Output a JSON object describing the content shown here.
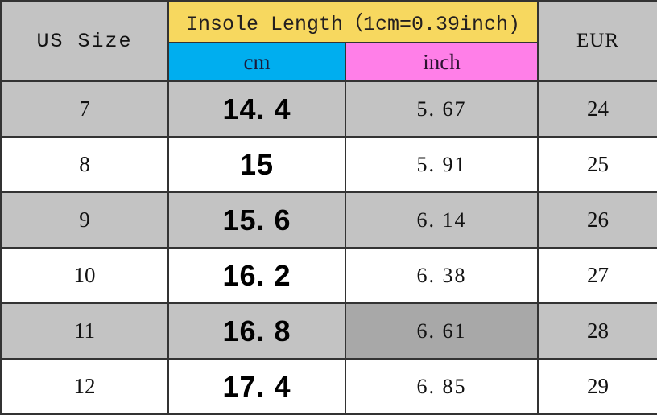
{
  "table": {
    "header": {
      "us_size_label": "US Size",
      "insole_label": "Insole Length（1cm=0.39inch)",
      "cm_label": "cm",
      "inch_label": "inch",
      "eur_label": "EUR"
    },
    "colors": {
      "insole_header_bg": "#F7D85F",
      "cm_header_bg": "#00AEEF",
      "inch_header_bg": "#FF7FE8",
      "row_gray_bg": "#C3C3C3",
      "row_white_bg": "#FFFFFF",
      "highlight_cell_bg": "#A8A8A8",
      "border": "#333333"
    },
    "columns": [
      "US Size",
      "cm",
      "inch",
      "EUR"
    ],
    "rows": [
      {
        "us": "7",
        "cm": "14. 4",
        "inch": "5. 67",
        "eur": "24",
        "shade": "gray",
        "highlight": ""
      },
      {
        "us": "8",
        "cm": "15",
        "inch": "5. 91",
        "eur": "25",
        "shade": "white",
        "highlight": ""
      },
      {
        "us": "9",
        "cm": "15. 6",
        "inch": "6. 14",
        "eur": "26",
        "shade": "gray",
        "highlight": ""
      },
      {
        "us": "10",
        "cm": "16. 2",
        "inch": "6. 38",
        "eur": "27",
        "shade": "white",
        "highlight": ""
      },
      {
        "us": "11",
        "cm": "16. 8",
        "inch": "6. 61",
        "eur": "28",
        "shade": "gray",
        "highlight": "inch"
      },
      {
        "us": "12",
        "cm": "17. 4",
        "inch": "6. 85",
        "eur": "29",
        "shade": "white",
        "highlight": ""
      }
    ]
  }
}
